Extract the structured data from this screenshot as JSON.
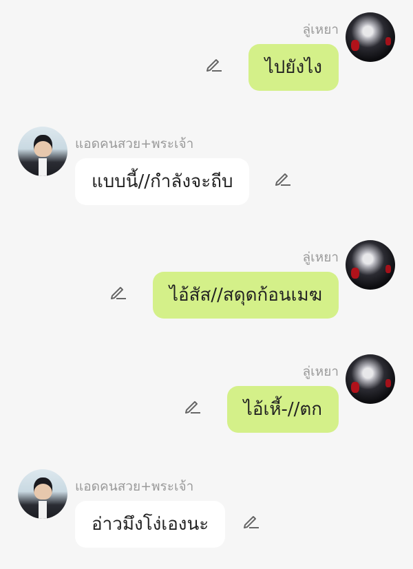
{
  "messages": [
    {
      "side": "right",
      "sender": "ลู่เหยา",
      "text": "ไปยังไง"
    },
    {
      "side": "left",
      "sender": "แอดคนสวย+พระเจ้า",
      "text": "แบบนี้//กำลังจะถีบ"
    },
    {
      "side": "right",
      "sender": "ลู่เหยา",
      "text": "ไอ้สัส//สดุดก้อนเมฆ"
    },
    {
      "side": "right",
      "sender": "ลู่เหยา",
      "text": "ไอ้เหี้-//ตก"
    },
    {
      "side": "left",
      "sender": "แอดคนสวย+พระเจ้า",
      "text": "อ่าวมึงโง่เองนะ"
    }
  ],
  "colors": {
    "sent_bubble": "#d4f089",
    "received_bubble": "#ffffff",
    "background": "#f6f6f6",
    "name": "#9a9a9a"
  },
  "icons": {
    "edit": "pencil-edit-icon"
  }
}
